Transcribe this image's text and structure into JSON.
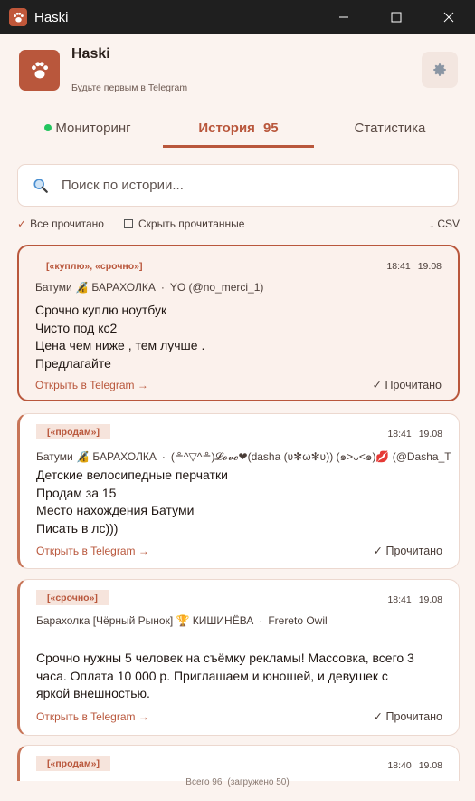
{
  "window": {
    "title": "Haski"
  },
  "header": {
    "name": "Haski",
    "subtitle": "Будьте первым в Telegram"
  },
  "tabs": [
    {
      "label": "Мониторинг"
    },
    {
      "label": "История",
      "count": "95"
    },
    {
      "label": "Статистика"
    }
  ],
  "search": {
    "placeholder": "Поиск по истории..."
  },
  "actions": {
    "mark_all_read": "Все прочитано",
    "hide_read": "Скрыть прочитанные",
    "csv": "CSV"
  },
  "messages": [
    {
      "tags": "[«куплю», «срочно»]",
      "time": "18:41",
      "date": "19.08",
      "source": "Батуми 🔏 БАРАХОЛКА",
      "author": "YO (@no_merci_1)",
      "body": "Срочно куплю  ноутбук\nЧисто под кс2\nЦена чем ниже , тем лучше .\nПредлагайте",
      "open_label": "Открыть в Telegram →",
      "read_label": "Прочитано"
    },
    {
      "tags": "[«продам»]",
      "time": "18:41",
      "date": "19.08",
      "source": "Батуми 🔏 БАРАХОЛКА",
      "author": "(≗^▽^≗)𝓛𝓸𝓿𝓮❤(dasha (ʋ✻ω✻ʋ)) (๑>ᴗ<๑)💋 (@Dasha_T",
      "body": "Детские велосипедные перчатки\nПродам за 15\nМесто нахождения Батуми\nПисать в лс)))",
      "open_label": "Открыть в Telegram →",
      "read_label": "Прочитано"
    },
    {
      "tags": "[«срочно»]",
      "time": "18:41",
      "date": "19.08",
      "source": "Барахолка [Чёрный Рынок] 🏆 КИШИНЁВА",
      "author": "Frereto Owil",
      "body": "Срочно нужны 5 человек на съёмку рекламы! Массовка, всего 3\nчаса. Оплата 10 000 р. Приглашаем и юношей, и девушек с\nяркой внешностью.",
      "open_label": "Открыть в Telegram →",
      "read_label": "Прочитано"
    },
    {
      "tags": "[«продам»]",
      "time": "18:40",
      "date": "19.08"
    }
  ],
  "footer": {
    "total": "Всего 96",
    "loaded": "(загружено 50)"
  },
  "colors": {
    "accent": "#b9573c",
    "background": "#fbf3ef",
    "online": "#22c55e"
  }
}
